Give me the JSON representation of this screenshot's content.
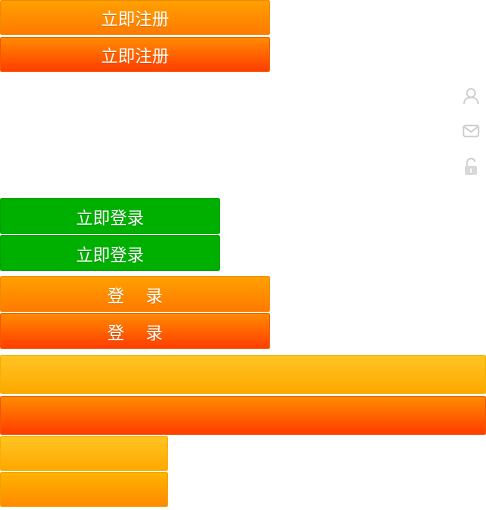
{
  "buttons": {
    "register_1": "立即注册",
    "register_2": "立即注册",
    "login_now_1": "立即登录",
    "login_now_2": "立即登录",
    "login_1": "登    录",
    "login_2": "登    录"
  },
  "colors": {
    "orange": "#ff8c00",
    "red_orange": "#ff4a00",
    "green": "#00b000",
    "yellow": "#ffb81a",
    "icon_gray": "#cccccc"
  },
  "icons": {
    "user": "user-icon",
    "mail": "mail-icon",
    "lock": "unlock-icon"
  }
}
